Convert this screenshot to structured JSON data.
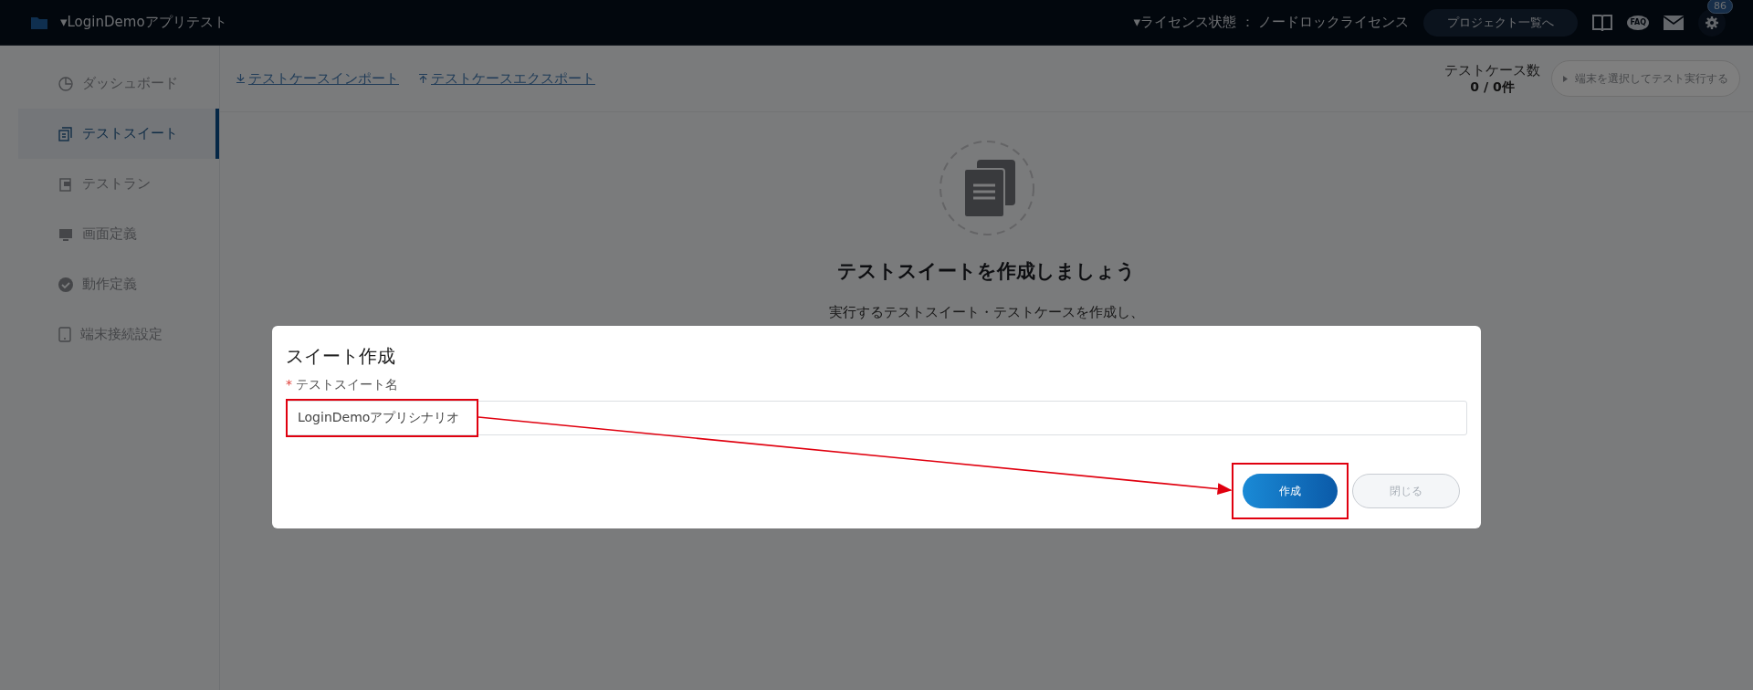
{
  "top_bar": {
    "project_title": "▾LoginDemoアプリテスト",
    "license_status": "▾ライセンス状態 ： ノードロックライセンス",
    "project_list_button": "プロジェクト一覧へ",
    "faq_label": "FAQ",
    "notification_count": "86"
  },
  "sidebar": {
    "items": [
      {
        "label": "ダッシュボード",
        "selected": false
      },
      {
        "label": "テストスイート",
        "selected": true
      },
      {
        "label": "テストラン",
        "selected": false
      },
      {
        "label": "画面定義",
        "selected": false
      },
      {
        "label": "動作定義",
        "selected": false
      },
      {
        "label": "端末接続設定",
        "selected": false
      }
    ]
  },
  "toolbar": {
    "links": [
      {
        "label": "テストケースインポート"
      },
      {
        "label": "テストケースエクスポート"
      }
    ],
    "test_case_count_label": "テストケース数",
    "test_case_count": "0 / 0件",
    "run_button": {
      "label": "端末を選択してテスト実行する",
      "disabled": true
    }
  },
  "empty_state": {
    "title": "テストスイートを作成しましょう",
    "description": "実行するテストスイート・テストケースを作成し、"
  },
  "dialog": {
    "title": "スイート作成",
    "field_label": "テストスイート名",
    "required_mark": "*",
    "field_value": "LoginDemoアプリシナリオ",
    "buttons": [
      {
        "label": "作成",
        "kind": "primary"
      },
      {
        "label": "閉じる",
        "kind": "secondary"
      }
    ]
  }
}
